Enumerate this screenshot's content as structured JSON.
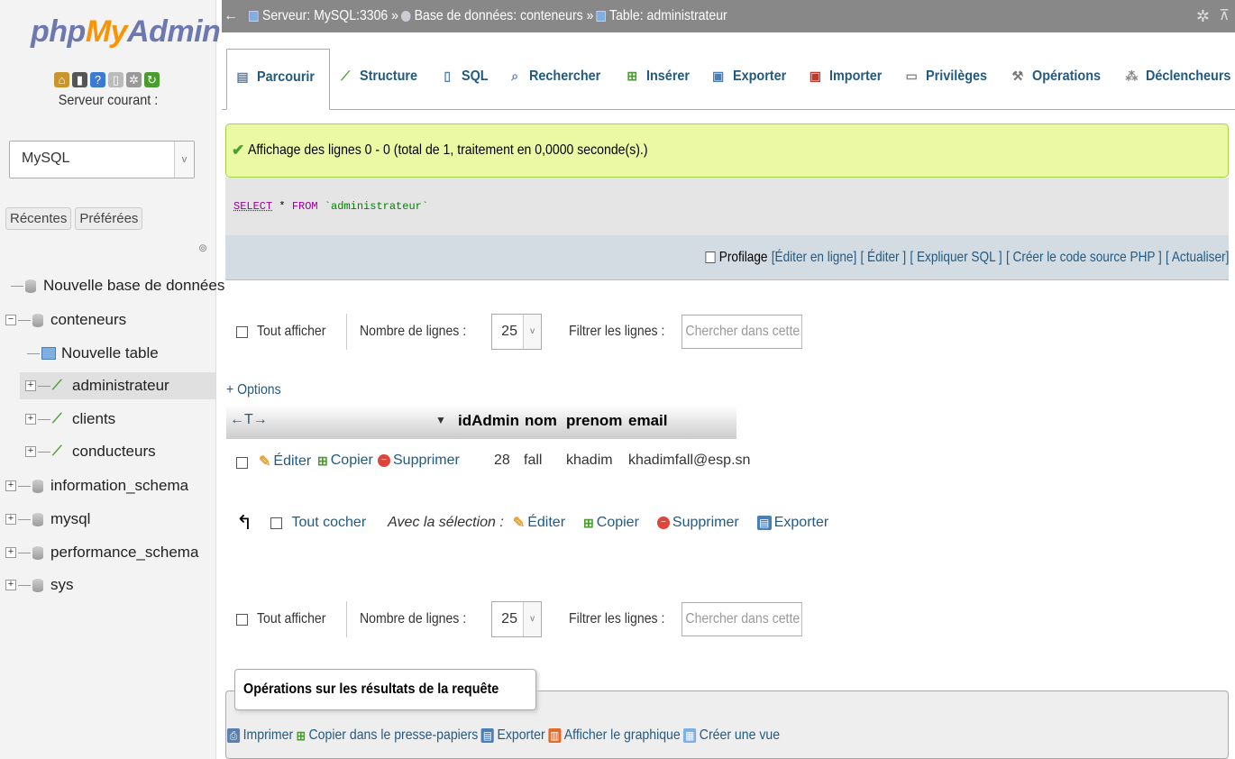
{
  "logo": {
    "php": "php",
    "my": "My",
    "admin": "Admin"
  },
  "nav": {
    "server_label": "Serveur courant :",
    "server_value": "MySQL",
    "tabs": [
      "Récentes",
      "Préférées"
    ],
    "tree": {
      "new_db": "Nouvelle base de données",
      "conteneurs": "conteneurs",
      "new_table": "Nouvelle table",
      "administrateur": "administrateur",
      "clients": "clients",
      "conducteurs": "conducteurs",
      "information_schema": "information_schema",
      "mysql": "mysql",
      "performance_schema": "performance_schema",
      "sys": "sys"
    }
  },
  "breadcrumb": {
    "server": "Serveur: MySQL:3306 »",
    "database": "Base de données: conteneurs »",
    "table": "Table: administrateur"
  },
  "tabs": {
    "browse": "Parcourir",
    "structure": "Structure",
    "sql": "SQL",
    "search": "Rechercher",
    "insert": "Insérer",
    "export": "Exporter",
    "import": "Importer",
    "privileges": "Privilèges",
    "operations": "Opérations",
    "triggers": "Déclencheurs"
  },
  "success_message": "Affichage des lignes 0 - 0 (total de 1, traitement en 0,0000 seconde(s).)",
  "sql": {
    "select": "SELECT",
    "star": "*",
    "from": "FROM",
    "table": "`administrateur`"
  },
  "sql_bar": {
    "profiling": "Profilage",
    "inline_edit": "[Éditer en ligne]",
    "edit": "[ Éditer ]",
    "explain": "[ Expliquer SQL ]",
    "php_code": "[ Créer le code source PHP ]",
    "refresh": "[ Actualiser]"
  },
  "nav_controls": {
    "show_all": "Tout afficher",
    "rows_label": "Nombre de lignes :",
    "rows_value": "25",
    "filter_label": "Filtrer les lignes :",
    "filter_placeholder": "Chercher dans cette tab"
  },
  "table": {
    "options": "+ Options",
    "arrows": "←T→",
    "columns": [
      "idAdmin",
      "nom",
      "prenom",
      "email"
    ],
    "row": {
      "idAdmin": "28",
      "nom": "fall",
      "prenom": "khadim",
      "email": "khadimfall@esp.sn"
    },
    "actions": {
      "edit": "Éditer",
      "copy": "Copier",
      "delete": "Supprimer"
    }
  },
  "with_selection": {
    "check_all": "Tout cocher",
    "label": "Avec la sélection :",
    "edit": "Éditer",
    "copy": "Copier",
    "delete": "Supprimer",
    "export": "Exporter"
  },
  "query_ops": {
    "legend": "Opérations sur les résultats de la requête",
    "print": "Imprimer",
    "copy_clipboard": "Copier dans le presse-papiers",
    "export": "Exporter",
    "chart": "Afficher le graphique",
    "create_view": "Créer une vue"
  },
  "colors": {
    "link": "#235a81",
    "success_bg": "#ebf8a4",
    "topbar": "#888888"
  }
}
